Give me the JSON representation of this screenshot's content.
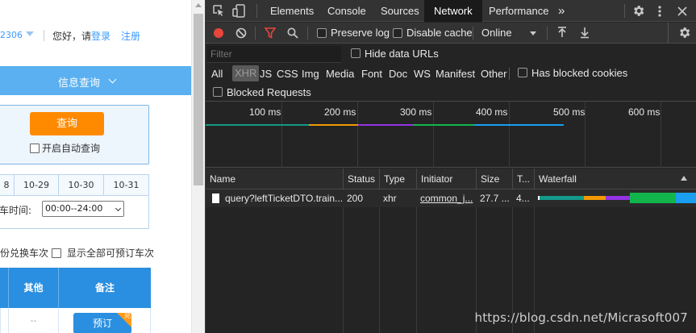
{
  "webpage": {
    "account_fragment": "2306",
    "greeting": "您好，请",
    "login_link": "登录",
    "register_link": "注册",
    "info_query_bar": "信息查询",
    "query_button": "查询",
    "auto_query_label": "开启自动查询",
    "dates": [
      "8",
      "10-29",
      "10-30",
      "10-31"
    ],
    "departure_time_label": "车时间:",
    "departure_time_value": "00:00--24:00",
    "option_exchange": "份兑换车次",
    "option_show_all": "显示全部可预订车次",
    "table_headers": [
      "",
      "其他",
      "备注"
    ],
    "table_row": {
      "other": "--",
      "book_button": "预订",
      "book_tag": "兑"
    }
  },
  "devtools": {
    "tabs": [
      "Elements",
      "Console",
      "Sources",
      "Network",
      "Performance"
    ],
    "active_tab": "Network",
    "more_tabs": "»",
    "toolbar": {
      "preserve_log": "Preserve log",
      "disable_cache": "Disable cache",
      "throttle": "Online"
    },
    "filter_placeholder": "Filter",
    "hide_data_urls": "Hide data URLs",
    "types": [
      "All",
      "XHR",
      "JS",
      "CSS",
      "Img",
      "Media",
      "Font",
      "Doc",
      "WS",
      "Manifest",
      "Other"
    ],
    "active_type": "XHR",
    "has_blocked_cookies": "Has blocked cookies",
    "blocked_requests": "Blocked Requests",
    "timeline_labels": [
      "100 ms",
      "200 ms",
      "300 ms",
      "400 ms",
      "500 ms",
      "600 ms"
    ],
    "columns": [
      "Name",
      "Status",
      "Type",
      "Initiator",
      "Size",
      "T...",
      "Waterfall"
    ],
    "request": {
      "name": "query?leftTicketDTO.train...",
      "status": "200",
      "type": "xhr",
      "initiator": "common_j...",
      "size": "27.7 ...",
      "time": "4..."
    },
    "colors": {
      "record": "#e8453c",
      "filter_icon": "#e8453c",
      "teal": "#129a8a",
      "orange": "#f29900",
      "purple": "#9334e6",
      "green": "#12b54b",
      "blue": "#1a9ff0"
    }
  },
  "watermark": "https://blog.csdn.net/Micrasoft007"
}
